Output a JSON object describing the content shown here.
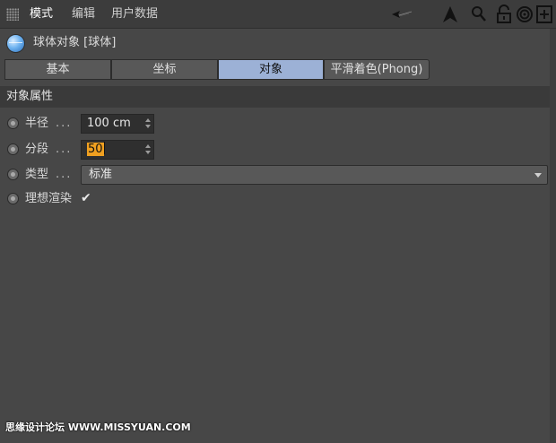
{
  "menubar": {
    "items": [
      {
        "label": "模式",
        "active": true
      },
      {
        "label": "编辑",
        "active": false
      },
      {
        "label": "用户数据",
        "active": false
      }
    ],
    "tools": [
      {
        "icon": "back-arrow-icon"
      },
      {
        "icon": "cursor-up-arrow-icon"
      },
      {
        "icon": "search-icon"
      },
      {
        "icon": "unlock-icon"
      },
      {
        "icon": "target-icon"
      },
      {
        "icon": "new-panel-icon"
      }
    ]
  },
  "object": {
    "title": "球体对象 [球体]",
    "icon": "sphere-icon"
  },
  "tabs": [
    {
      "label": "基本",
      "active": false
    },
    {
      "label": "坐标",
      "active": false
    },
    {
      "label": "对象",
      "active": true
    },
    {
      "label": "平滑着色(Phong)",
      "active": false
    }
  ],
  "section": {
    "title": "对象属性"
  },
  "properties": {
    "radius": {
      "label": "半径",
      "dots": "...",
      "value": "100 cm"
    },
    "segments": {
      "label": "分段",
      "dots": "...",
      "value": "50"
    },
    "type": {
      "label": "类型",
      "dots": "...",
      "value": "标准"
    },
    "render": {
      "label": "理想渲染",
      "checked": true,
      "mark": "✔"
    }
  },
  "watermark": {
    "text": "思缘设计论坛 WWW.MISSYUAN.COM"
  },
  "colors": {
    "background": "#474747",
    "active_tab": "#9cb1d6",
    "edit_highlight": "#f0a020"
  }
}
